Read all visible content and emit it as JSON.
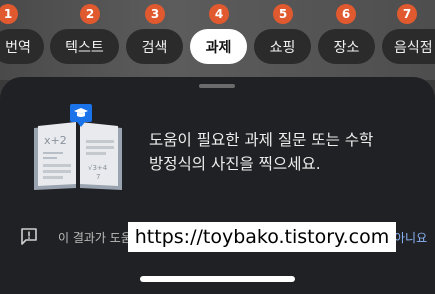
{
  "mode_chips": [
    {
      "label": "번역",
      "badge": "1"
    },
    {
      "label": "텍스트",
      "badge": "2"
    },
    {
      "label": "검색",
      "badge": "3"
    },
    {
      "label": "과제",
      "badge": "4"
    },
    {
      "label": "쇼핑",
      "badge": "5"
    },
    {
      "label": "장소",
      "badge": "6"
    },
    {
      "label": "음식점",
      "badge": "7"
    }
  ],
  "active_chip": "과제",
  "prompt": {
    "line1": "도움이 필요한 과제 질문 또는 수학",
    "line2": "방정식의 사진을 찍으세요."
  },
  "illustration": {
    "left_page_text": "x+2",
    "right_page_text": "√3+4",
    "right_page_sub": "7"
  },
  "feedback": {
    "question": "이 결과가 도움이 되었나요?",
    "no_label": "아니요"
  },
  "watermark": "https://toybako.tistory.com",
  "colors": {
    "badge": "#e0592f",
    "sheet": "#202124",
    "link": "#8ab4f8"
  }
}
